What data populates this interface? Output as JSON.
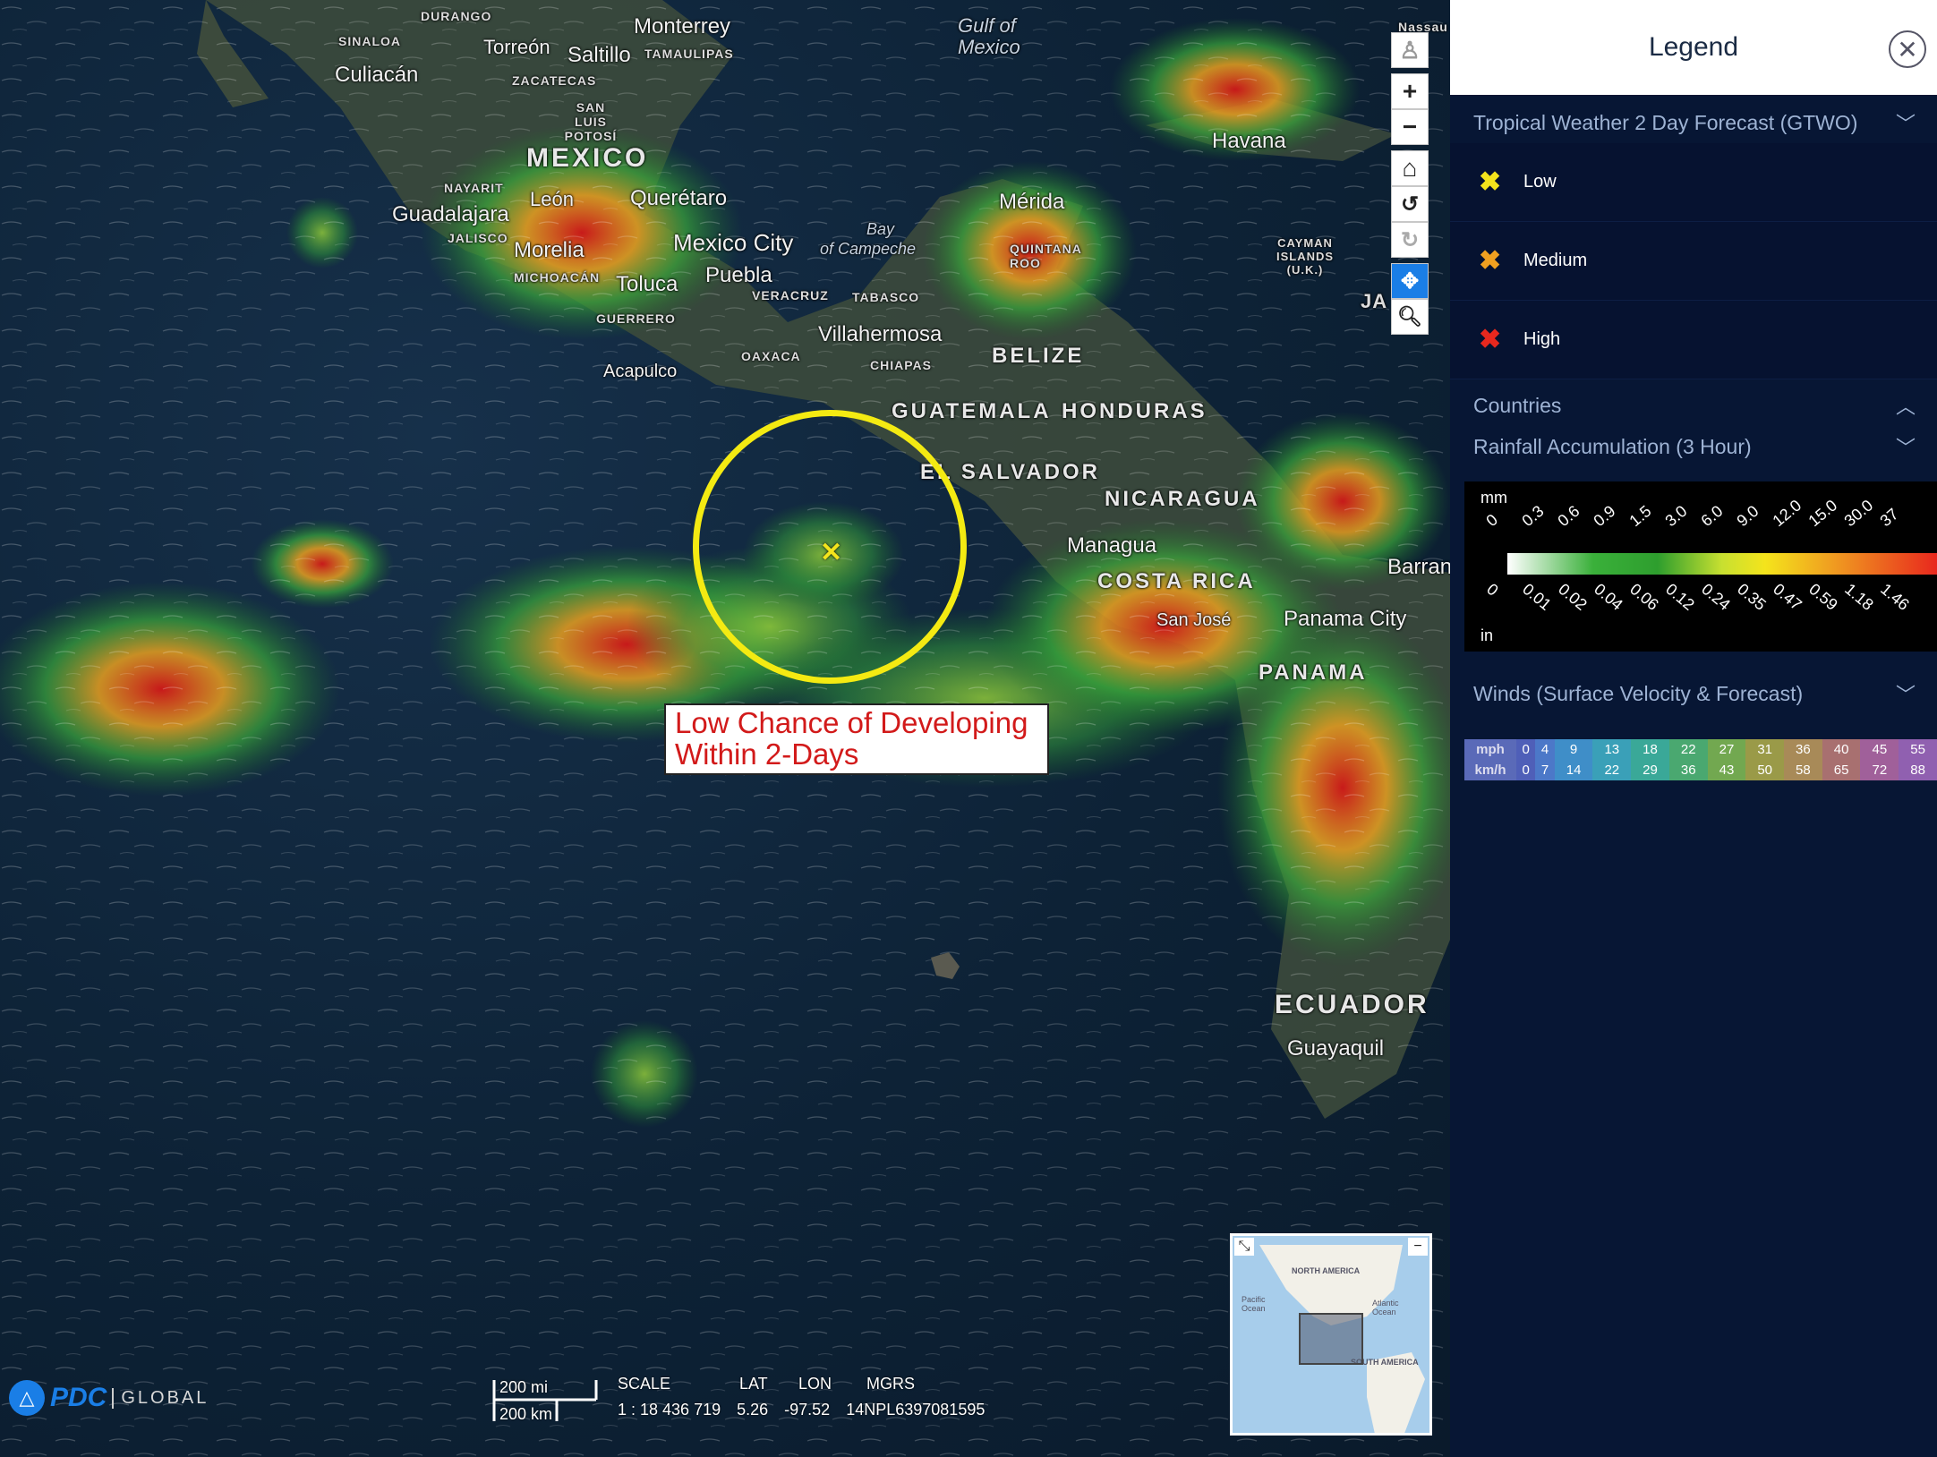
{
  "map": {
    "labels": {
      "durango": "DURANGO",
      "sinaloa": "SINALOA",
      "culiacan": "Culiacán",
      "torreon": "Torreón",
      "monterrey": "Monterrey",
      "saltillo": "Saltillo",
      "tamaulipas": "TAMAULIPAS",
      "zacatecas": "ZACATECAS",
      "san_luis_potosi": "SAN LUIS POTOSÍ",
      "mexico": "MEXICO",
      "nayarit": "NAYARIT",
      "leon": "León",
      "queretaro": "Querétaro",
      "guadalajara": "Guadalajara",
      "jalisco": "JALISCO",
      "morelia": "Morelia",
      "michoacan": "MICHOACÁN",
      "toluca": "Toluca",
      "mexico_city": "Mexico City",
      "puebla": "Puebla",
      "veracruz": "VERACRUZ",
      "tabasco": "TABASCO",
      "guerrero": "GUERRERO",
      "acapulco": "Acapulco",
      "oaxaca": "OAXACA",
      "villahermosa": "Villahermosa",
      "chiapas": "CHIAPAS",
      "gulf_of_mexico_1": "Gulf of",
      "gulf_of_mexico_2": "Mexico",
      "bay_1": "Bay",
      "bay_2": "of Campeche",
      "merida": "Mérida",
      "quintana_roo": "QUINTANA ROO",
      "havana": "Havana",
      "cayman": "CAYMAN ISLANDS (U.K.)",
      "belize": "BELIZE",
      "guatemala": "GUATEMALA",
      "honduras": "HONDURAS",
      "el_salvador": "EL SALVADOR",
      "nicaragua": "NICARAGUA",
      "managua": "Managua",
      "costa_rica": "COSTA RICA",
      "san_jose": "San José",
      "panama_city": "Panama City",
      "panama": "PANAMA",
      "barran": "Barran",
      "nassau": "Nassau",
      "ecuador": "ECUADOR",
      "guayaquil": "Guayaquil",
      "jamaica": "JA   IC"
    },
    "annotation": {
      "line1": "Low Chance of Developing",
      "line2": "Within 2-Days"
    },
    "minimap": {
      "north_america": "NORTH AMERICA",
      "pacific": "Pacific Ocean",
      "atlantic": "Atlantic Ocean",
      "south_america": "SOUTH AMERICA"
    },
    "footer": {
      "logo_text": "PDC",
      "logo_sub": "GLOBAL",
      "scale_mi": "200 mi",
      "scale_km": "200 km",
      "scale_label": "SCALE",
      "lat_label": "LAT",
      "lon_label": "LON",
      "mgrs_label": "MGRS",
      "scale_value": "1 : 18 436 719",
      "lat_value": "5.26",
      "lon_value": "-97.52",
      "mgrs_value": "14NPL6397081595"
    },
    "toolbar_icons": [
      "street-view-icon",
      "zoom-in-icon",
      "zoom-out-icon",
      "home-icon",
      "rotate-left-icon",
      "rotate-right-icon",
      "pan-icon",
      "zoom-box-icon"
    ]
  },
  "legend": {
    "title": "Legend",
    "sections": {
      "gtwo": "Tropical Weather 2 Day Forecast (GTWO)",
      "countries": "Countries",
      "rainfall": "Rainfall Accumulation (3 Hour)",
      "winds": "Winds (Surface Velocity & Forecast)"
    },
    "gtwo_items": [
      {
        "label": "Low",
        "color": "#f4e41c"
      },
      {
        "label": "Medium",
        "color": "#f0a020"
      },
      {
        "label": "High",
        "color": "#e8281e"
      }
    ],
    "rain": {
      "mm_unit": "mm",
      "in_unit": "in",
      "mm_ticks": [
        "0",
        "0.3",
        "0.6",
        "0.9",
        "1.5",
        "3.0",
        "6.0",
        "9.0",
        "12.0",
        "15.0",
        "30.0",
        "37"
      ],
      "in_ticks": [
        "0",
        "0.01",
        "0.02",
        "0.04",
        "0.06",
        "0.12",
        "0.24",
        "0.35",
        "0.47",
        "0.59",
        "1.18",
        "1.46"
      ]
    },
    "winds": {
      "mph_label": "mph",
      "kmh_label": "km/h",
      "mph": [
        "0",
        "4",
        "9",
        "13",
        "18",
        "22",
        "27",
        "31",
        "36",
        "40",
        "45",
        "55"
      ],
      "kmh": [
        "0",
        "7",
        "14",
        "22",
        "29",
        "36",
        "43",
        "50",
        "58",
        "65",
        "72",
        "88"
      ],
      "colors": [
        "#4f5fb8",
        "#4c78c8",
        "#3f8ec8",
        "#3aa0b8",
        "#3aa898",
        "#4aa870",
        "#72a850",
        "#9a9a48",
        "#a88a58",
        "#a87070",
        "#a0609a",
        "#9060b0"
      ]
    },
    "colors": {
      "accent": "#1a7ee6",
      "panel_bg": "#071634",
      "section_text": "#9eb3d4"
    }
  }
}
